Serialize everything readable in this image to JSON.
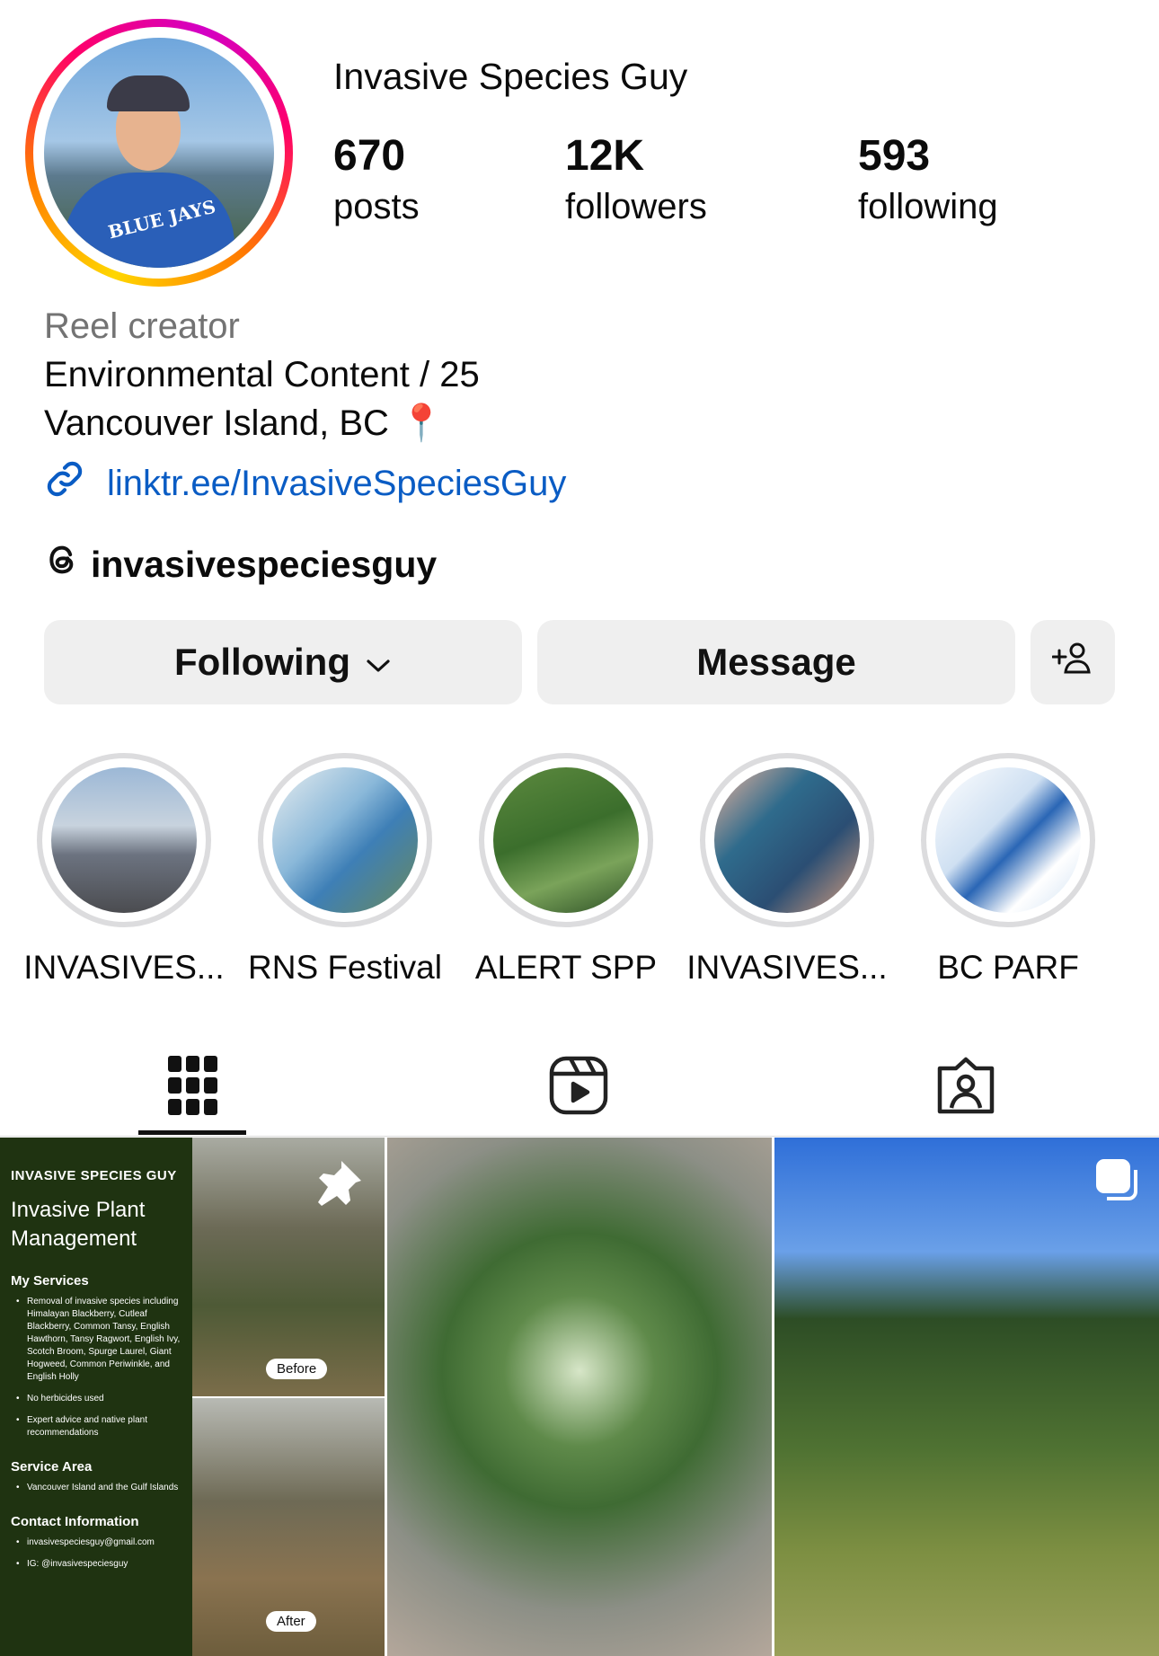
{
  "profile": {
    "name": "Invasive Species Guy",
    "stats": {
      "posts_count": "670",
      "posts_label": "posts",
      "followers_count": "12K",
      "followers_label": "followers",
      "following_count": "593",
      "following_label": "following"
    },
    "bio": {
      "category": "Reel creator",
      "line1": "Environmental Content / 25",
      "line2": "Vancouver Island, BC 📍"
    },
    "link": "linktr.ee/InvasiveSpeciesGuy",
    "threads_handle": "invasivespeciesguy"
  },
  "actions": {
    "following_label": "Following",
    "message_label": "Message"
  },
  "highlights": [
    {
      "label": "INVASIVES..."
    },
    {
      "label": "RNS Festival"
    },
    {
      "label": "ALERT SPP"
    },
    {
      "label": "INVASIVES..."
    },
    {
      "label": "BC PARF"
    }
  ],
  "tabs": [
    {
      "icon": "grid-icon",
      "active": true
    },
    {
      "icon": "reels-icon",
      "active": false
    },
    {
      "icon": "tagged-icon",
      "active": false
    }
  ],
  "posts": {
    "first": {
      "pinned": true,
      "brand": "INVASIVE SPECIES GUY",
      "headline": "Invasive Plant Management",
      "services_title": "My Services",
      "services": [
        "Removal of invasive species including Himalayan Blackberry, Cutleaf Blackberry, Common Tansy, English Hawthorn, Tansy Ragwort, English Ivy, Scotch Broom, Spurge Laurel, Giant Hogweed, Common Periwinkle, and English Holly",
        "No herbicides used",
        "Expert advice and native plant recommendations"
      ],
      "area_title": "Service Area",
      "area": [
        "Vancouver Island and the Gulf Islands"
      ],
      "contact_title": "Contact Information",
      "contact": [
        "invasivespeciesguy@gmail.com",
        "IG: @invasivespeciesguy"
      ],
      "before_label": "Before",
      "after_label": "After"
    },
    "third": {
      "carousel": true
    }
  },
  "colors": {
    "link": "#0a5cc4",
    "button_bg": "#efefef",
    "muted_text": "#737373",
    "flyer_bg": "#1f3311"
  }
}
